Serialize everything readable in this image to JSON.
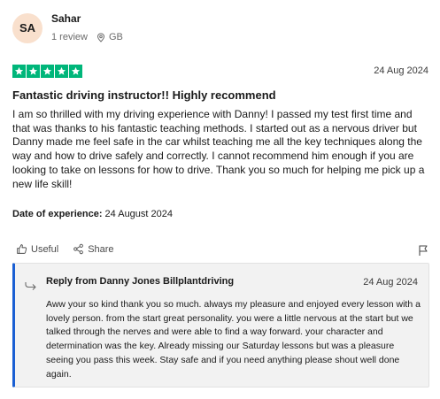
{
  "reviewer": {
    "initials": "SA",
    "name": "Sahar",
    "reviews": "1 review",
    "country": "GB"
  },
  "review": {
    "rating": 5,
    "date": "24 Aug 2024",
    "title": "Fantastic driving instructor!! Highly recommend",
    "text": "I am so thrilled with my driving experience with Danny! I passed my test first time and that was thanks to his fantastic teaching methods. I started out as a nervous driver but Danny made me feel safe in the car whilst teaching me all the key techniques along the way and how to drive safely and correctly. I cannot recommend him enough if you are looking to take on lessons for how to drive. Thank you so much for helping me pick up a new life skill!",
    "experience_label": "Date of experience:",
    "experience_date": "24 August 2024"
  },
  "actions": {
    "useful": "Useful",
    "share": "Share"
  },
  "reply": {
    "heading": "Reply from Danny Jones Billplantdriving",
    "date": "24 Aug 2024",
    "text": "Aww your so kind thank you so much. always my pleasure and enjoyed every lesson with a lovely person. from the start great personality. you were a little nervous at the start but we talked through the nerves and were able to find a way forward. your character and determination was the key. Already missing our Saturday lessons but was a pleasure seeing you pass this week. Stay safe and if you need anything please shout well done again."
  },
  "colors": {
    "star_green": "#00b67a",
    "avatar_bg": "#f9e0cd",
    "reply_border": "#1a5fd3",
    "reply_bg": "#f2f2f2"
  },
  "icons": [
    "location-pin-icon",
    "star-icon",
    "thumbs-up-icon",
    "share-icon",
    "flag-icon",
    "reply-arrow-icon"
  ]
}
